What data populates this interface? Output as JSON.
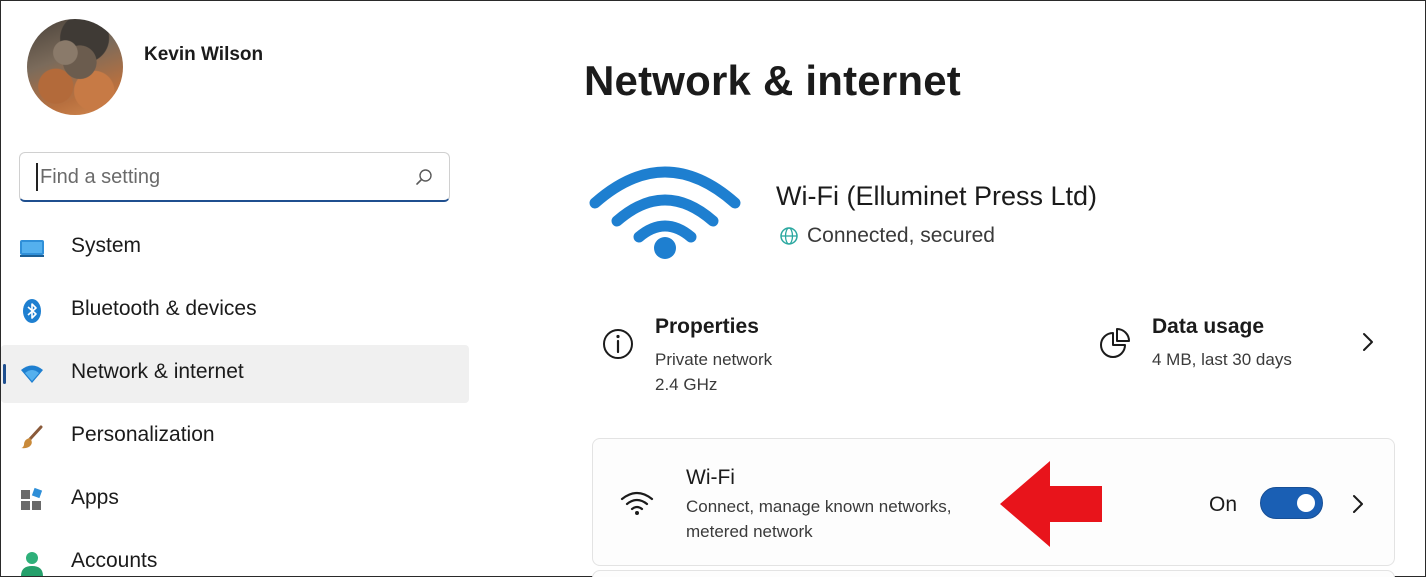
{
  "user": {
    "name": "Kevin Wilson"
  },
  "search": {
    "placeholder": "Find a setting",
    "icon": "search-icon"
  },
  "sidebar": {
    "items": [
      {
        "label": "System",
        "icon": "monitor-icon"
      },
      {
        "label": "Bluetooth & devices",
        "icon": "bluetooth-icon"
      },
      {
        "label": "Network & internet",
        "icon": "wifi-icon",
        "active": true
      },
      {
        "label": "Personalization",
        "icon": "paintbrush-icon"
      },
      {
        "label": "Apps",
        "icon": "apps-icon"
      },
      {
        "label": "Accounts",
        "icon": "person-icon"
      }
    ]
  },
  "main": {
    "title": "Network & internet",
    "connection": {
      "name": "Wi-Fi (Elluminet Press Ltd)",
      "status": "Connected, secured"
    },
    "properties": {
      "title": "Properties",
      "line1": "Private network",
      "line2": "2.4 GHz"
    },
    "data_usage": {
      "title": "Data usage",
      "subtitle": "4 MB, last 30 days"
    },
    "wifi_card": {
      "title": "Wi-Fi",
      "line1": "Connect, manage known networks,",
      "line2": "metered network",
      "toggle_label": "On",
      "toggle_on": true
    }
  },
  "colors": {
    "accent": "#1a5fb4",
    "wifi_blue": "#1e7fd0",
    "arrow_red": "#e8141b"
  }
}
